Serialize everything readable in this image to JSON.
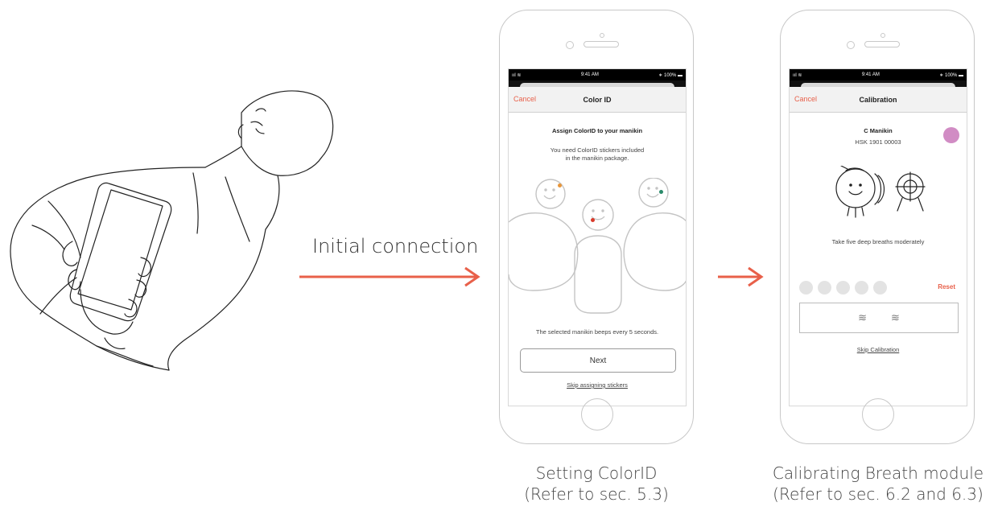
{
  "left_label": "Initial connection",
  "accent_color": "#e8604a",
  "status": {
    "signal": "ııl ≋",
    "time": "9:41 AM",
    "battery": "∗ 100% ▬"
  },
  "phone1": {
    "cancel": "Cancel",
    "title": "Color ID",
    "heading": "Assign ColorID to your manikin",
    "desc_line1": "You need ColorID stickers included",
    "desc_line2": "in the manikin package.",
    "beep_text": "The selected manikin beeps every 5 seconds.",
    "next_label": "Next",
    "skip_link": "Skip assigning stickers",
    "sticker_colors": [
      "#e8963a",
      "#d93a2a",
      "#2a8a6a"
    ],
    "caption_line1": "Setting ColorID",
    "caption_line2": "(Refer to sec. 5.3)"
  },
  "phone2": {
    "cancel": "Cancel",
    "title": "Calibration",
    "manikin_name": "C Manikin",
    "manikin_serial": "HSK 1901 00003",
    "manikin_color": "#d18cc4",
    "instruction": "Take five deep breaths moderately",
    "reset_label": "Reset",
    "breath_icons": [
      "≋",
      "≋"
    ],
    "breath_count_total": 5,
    "breath_count_done": 0,
    "skip_link": "Skip Calibration",
    "caption_line1": "Calibrating Breath module",
    "caption_line2": "(Refer to sec. 6.2 and 6.3)"
  }
}
